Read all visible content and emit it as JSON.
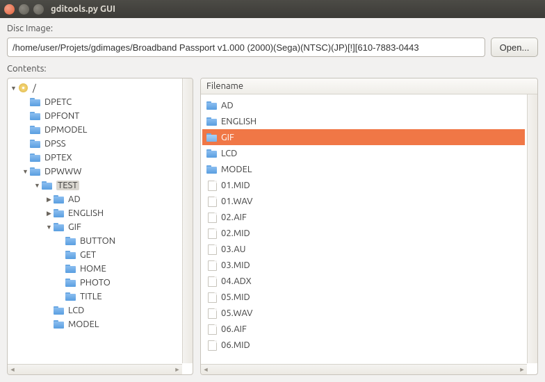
{
  "window": {
    "title": "gditools.py GUI"
  },
  "labels": {
    "disc_image": "Disc Image:",
    "contents": "Contents:"
  },
  "path": {
    "value": "/home/user/Projets/gdimages/Broadband Passport v1.000 (2000)(Sega)(NTSC)(JP)[!][610-7883-0443"
  },
  "buttons": {
    "open": "Open..."
  },
  "filelist": {
    "header": "Filename",
    "selected_index": 2,
    "items": [
      {
        "name": "AD",
        "type": "folder"
      },
      {
        "name": "ENGLISH",
        "type": "folder"
      },
      {
        "name": "GIF",
        "type": "folder"
      },
      {
        "name": "LCD",
        "type": "folder"
      },
      {
        "name": "MODEL",
        "type": "folder"
      },
      {
        "name": "01.MID",
        "type": "file"
      },
      {
        "name": "01.WAV",
        "type": "file"
      },
      {
        "name": "02.AIF",
        "type": "file"
      },
      {
        "name": "02.MID",
        "type": "file"
      },
      {
        "name": "03.AU",
        "type": "file"
      },
      {
        "name": "03.MID",
        "type": "file"
      },
      {
        "name": "04.ADX",
        "type": "file"
      },
      {
        "name": "05.MID",
        "type": "file"
      },
      {
        "name": "05.WAV",
        "type": "file"
      },
      {
        "name": "06.AIF",
        "type": "file"
      },
      {
        "name": "06.MID",
        "type": "file"
      }
    ]
  },
  "tree": {
    "root_label": "/",
    "selected_path": "DPWWW/TEST",
    "nodes": [
      {
        "label": "DPETC",
        "depth": 1,
        "exp": "",
        "icon": "folder"
      },
      {
        "label": "DPFONT",
        "depth": 1,
        "exp": "",
        "icon": "folder"
      },
      {
        "label": "DPMODEL",
        "depth": 1,
        "exp": "",
        "icon": "folder"
      },
      {
        "label": "DPSS",
        "depth": 1,
        "exp": "",
        "icon": "folder"
      },
      {
        "label": "DPTEX",
        "depth": 1,
        "exp": "",
        "icon": "folder"
      },
      {
        "label": "DPWWW",
        "depth": 1,
        "exp": "open",
        "icon": "folder"
      },
      {
        "label": "TEST",
        "depth": 2,
        "exp": "open",
        "icon": "folder",
        "selected": true
      },
      {
        "label": "AD",
        "depth": 3,
        "exp": "closed",
        "icon": "folder"
      },
      {
        "label": "ENGLISH",
        "depth": 3,
        "exp": "closed",
        "icon": "folder"
      },
      {
        "label": "GIF",
        "depth": 3,
        "exp": "open",
        "icon": "folder"
      },
      {
        "label": "BUTTON",
        "depth": 4,
        "exp": "",
        "icon": "folder"
      },
      {
        "label": "GET",
        "depth": 4,
        "exp": "",
        "icon": "folder"
      },
      {
        "label": "HOME",
        "depth": 4,
        "exp": "",
        "icon": "folder"
      },
      {
        "label": "PHOTO",
        "depth": 4,
        "exp": "",
        "icon": "folder"
      },
      {
        "label": "TITLE",
        "depth": 4,
        "exp": "",
        "icon": "folder"
      },
      {
        "label": "LCD",
        "depth": 3,
        "exp": "",
        "icon": "folder"
      },
      {
        "label": "MODEL",
        "depth": 3,
        "exp": "",
        "icon": "folder"
      }
    ]
  }
}
